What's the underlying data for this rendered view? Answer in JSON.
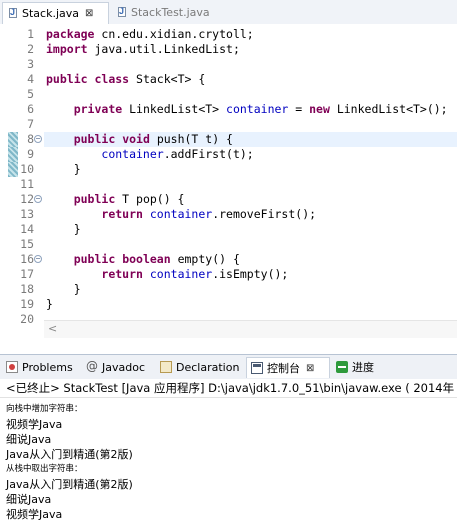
{
  "editor_tabs": [
    {
      "label": "Stack.java",
      "active": true,
      "close": "⊠"
    },
    {
      "label": "StackTest.java",
      "active": false
    }
  ],
  "code_lines": [
    {
      "n": "1",
      "tokens": [
        [
          "kw",
          "package"
        ],
        [
          "t",
          " cn.edu.xidian.crytoll;"
        ]
      ]
    },
    {
      "n": "2",
      "tokens": [
        [
          "kw",
          "import"
        ],
        [
          "t",
          " java.util.LinkedList;"
        ]
      ]
    },
    {
      "n": "3",
      "tokens": []
    },
    {
      "n": "4",
      "tokens": [
        [
          "kw",
          "public"
        ],
        [
          "t",
          " "
        ],
        [
          "kw",
          "class"
        ],
        [
          "t",
          " Stack<T> {"
        ]
      ]
    },
    {
      "n": "5",
      "tokens": []
    },
    {
      "n": "6",
      "tokens": [
        [
          "t",
          "    "
        ],
        [
          "kw",
          "private"
        ],
        [
          "t",
          " LinkedList<T> "
        ],
        [
          "fld",
          "container"
        ],
        [
          "t",
          " = "
        ],
        [
          "kw",
          "new"
        ],
        [
          "t",
          " LinkedList<T>();"
        ]
      ]
    },
    {
      "n": "7",
      "tokens": []
    },
    {
      "n": "8",
      "fold": "⊖",
      "tokens": [
        [
          "t",
          "    "
        ],
        [
          "kw",
          "public"
        ],
        [
          "t",
          " "
        ],
        [
          "kw",
          "void"
        ],
        [
          "t",
          " push(T t) {"
        ]
      ]
    },
    {
      "n": "9",
      "tokens": [
        [
          "t",
          "        "
        ],
        [
          "fld",
          "container"
        ],
        [
          "t",
          ".addFirst(t);"
        ]
      ]
    },
    {
      "n": "10",
      "tokens": [
        [
          "t",
          "    }"
        ]
      ]
    },
    {
      "n": "11",
      "tokens": []
    },
    {
      "n": "12",
      "fold": "⊖",
      "tokens": [
        [
          "t",
          "    "
        ],
        [
          "kw",
          "public"
        ],
        [
          "t",
          " T pop() {"
        ]
      ]
    },
    {
      "n": "13",
      "tokens": [
        [
          "t",
          "        "
        ],
        [
          "kw",
          "return"
        ],
        [
          "t",
          " "
        ],
        [
          "fld",
          "container"
        ],
        [
          "t",
          ".removeFirst();"
        ]
      ]
    },
    {
      "n": "14",
      "tokens": [
        [
          "t",
          "    }"
        ]
      ]
    },
    {
      "n": "15",
      "tokens": []
    },
    {
      "n": "16",
      "fold": "⊖",
      "tokens": [
        [
          "t",
          "    "
        ],
        [
          "kw",
          "public"
        ],
        [
          "t",
          " "
        ],
        [
          "kw",
          "boolean"
        ],
        [
          "t",
          " empty() {"
        ]
      ]
    },
    {
      "n": "17",
      "tokens": [
        [
          "t",
          "        "
        ],
        [
          "kw",
          "return"
        ],
        [
          "t",
          " "
        ],
        [
          "fld",
          "container"
        ],
        [
          "t",
          ".isEmpty();"
        ]
      ]
    },
    {
      "n": "18",
      "tokens": [
        [
          "t",
          "    }"
        ]
      ]
    },
    {
      "n": "19",
      "tokens": [
        [
          "t",
          "}"
        ]
      ]
    },
    {
      "n": "20",
      "tokens": []
    }
  ],
  "current_line": "8",
  "scroll_arrow": "<",
  "view_tabs": [
    {
      "label": "Problems",
      "icon": "problems-icon",
      "active": false
    },
    {
      "label": "Javadoc",
      "icon": "javadoc-icon",
      "active": false
    },
    {
      "label": "Declaration",
      "icon": "declaration-icon",
      "active": false
    },
    {
      "label": "控制台",
      "icon": "console-icon",
      "active": true,
      "close": "⊠"
    },
    {
      "label": "进度",
      "icon": "progress-icon",
      "active": false
    }
  ],
  "console": {
    "header": "<已终止> StackTest [Java 应用程序] D:\\java\\jdk1.7.0_51\\bin\\javaw.exe ( 2014年",
    "lines": [
      {
        "text": "向栈中增加字符串：",
        "small": true
      },
      {
        "text": "视频学Java",
        "small": false
      },
      {
        "text": "细说Java",
        "small": false
      },
      {
        "text": "Java从入门到精通(第2版)",
        "small": false
      },
      {
        "text": "从栈中取出字符串：",
        "small": true
      },
      {
        "text": "Java从入门到精通(第2版)",
        "small": false
      },
      {
        "text": "细说Java",
        "small": false
      },
      {
        "text": "视频学Java",
        "small": false
      }
    ]
  }
}
